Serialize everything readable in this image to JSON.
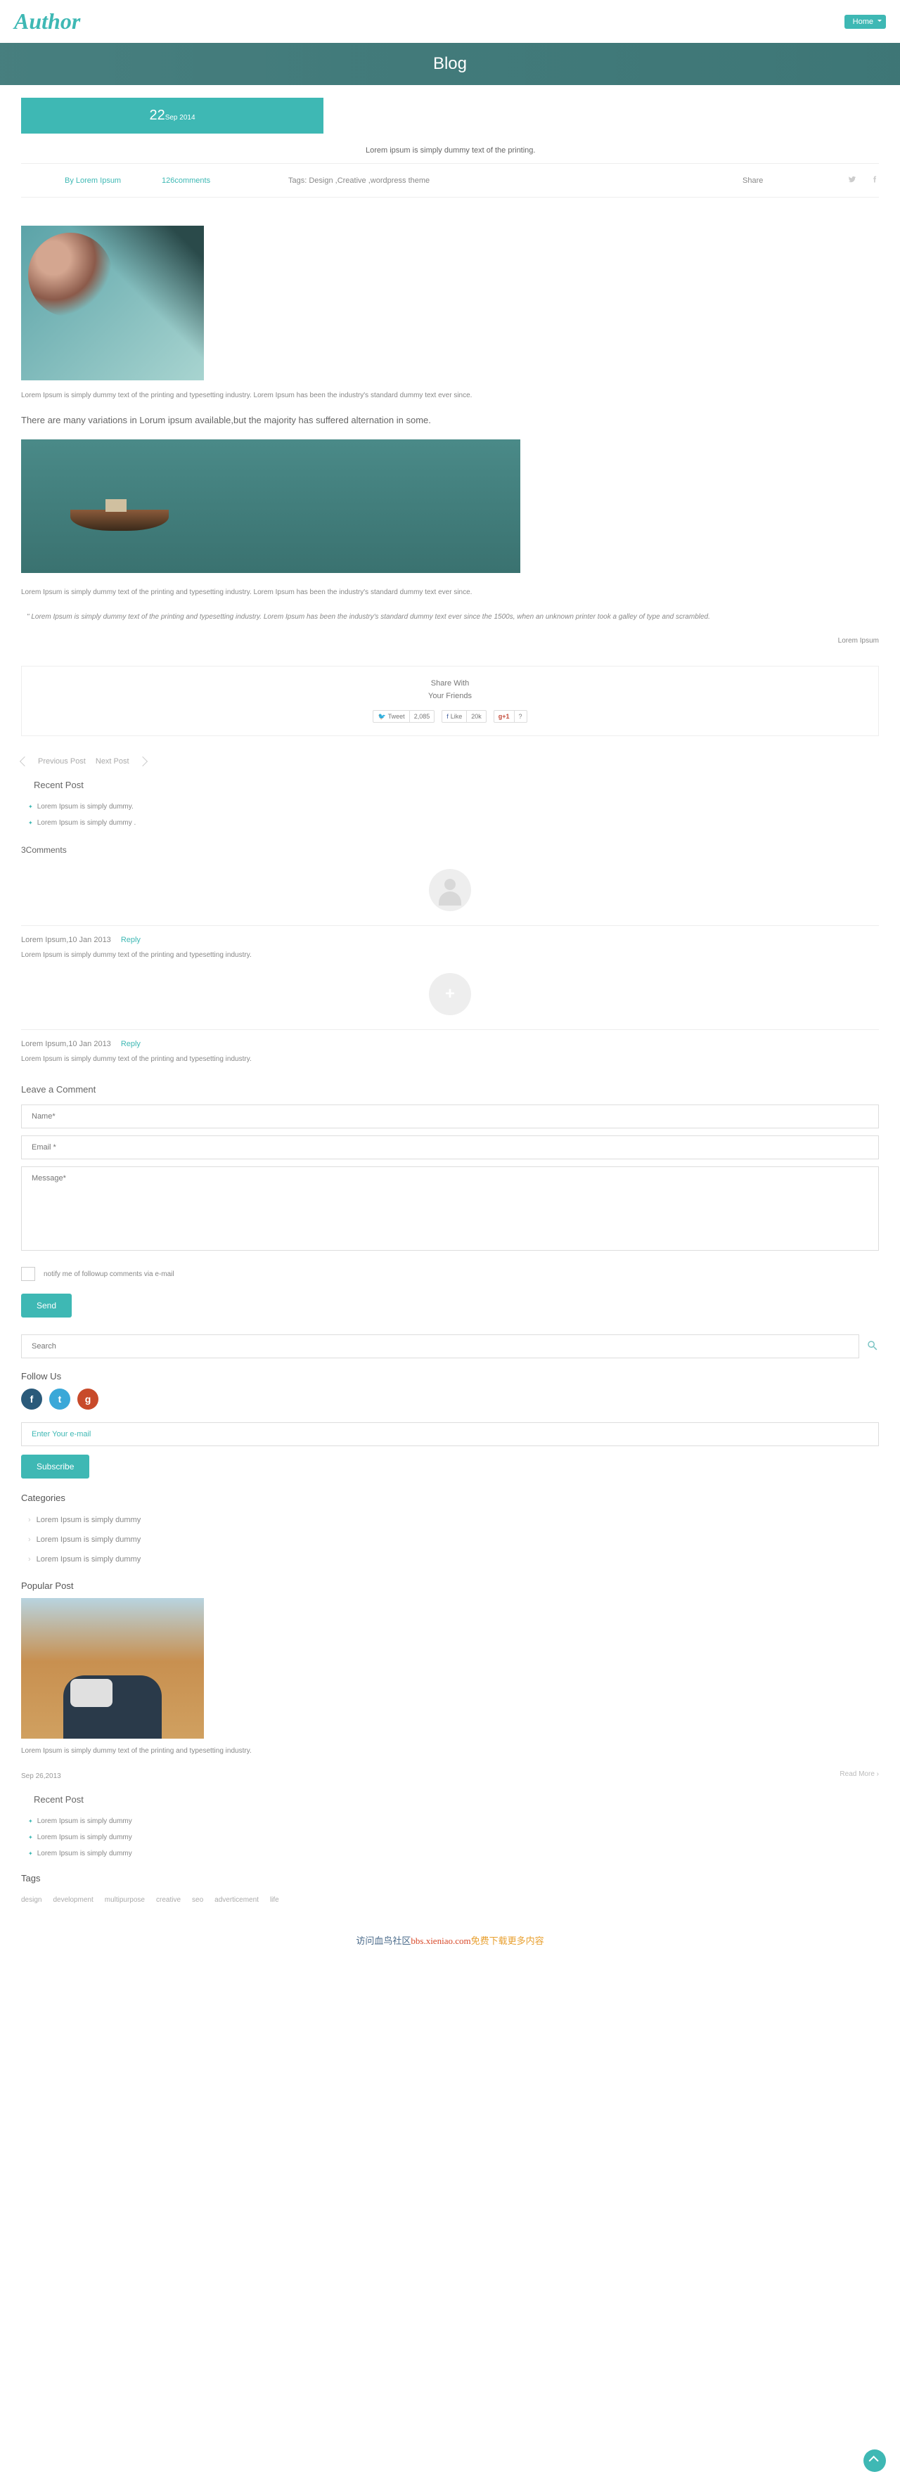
{
  "header": {
    "logo": "Author",
    "home_label": "Home"
  },
  "banner": {
    "title": "Blog"
  },
  "post": {
    "date_day": "22",
    "date_rest": "Sep 2014",
    "title": "Lorem ipsum is simply dummy text of the printing.",
    "by_label": "By",
    "author": "Lorem Ipsum",
    "comments": "126comments",
    "tags_label": "Tags: Design  ,Creative  ,wordpress theme",
    "share_label": "Share",
    "p1": "Lorem Ipsum is simply dummy text of the printing and typesetting industry. Lorem Ipsum has been the industry's standard dummy text ever since.",
    "h1": "There are many variations in Lorum ipsum available,but the majority has suffered alternation in some.",
    "p2": "Lorem Ipsum is simply dummy text of the printing and typesetting industry. Lorem Ipsum has been the industry's standard dummy text ever since.",
    "quote": "\"  Lorem Ipsum is simply dummy text of the printing and typesetting industry. Lorem Ipsum has been the industry's standard dummy text ever since the 1500s, when an unknown printer took a galley of type and scrambled.",
    "quote_src": "Lorem Ipsum"
  },
  "share_box": {
    "l1": "Share With",
    "l2": "Your Friends",
    "tweet": "Tweet",
    "tweet_n": "2,085",
    "like": "Like",
    "like_n": "20k",
    "gplus": "g+1",
    "gplus_n": "?"
  },
  "nav": {
    "prev": "Previous Post",
    "next": "Next Post"
  },
  "recent": {
    "title": "Recent Post",
    "items": [
      "Lorem Ipsum is simply dummy.",
      "Lorem Ipsum is simply dummy ."
    ]
  },
  "comments": {
    "heading": "3Comments",
    "items": [
      {
        "meta": "Lorem Ipsum,10 Jan 2013",
        "reply": "Reply",
        "text": "Lorem Ipsum is simply dummy text of the printing and typesetting industry."
      },
      {
        "meta": "Lorem Ipsum,10 Jan 2013",
        "reply": "Reply",
        "text": "Lorem Ipsum is simply dummy text of the printing and typesetting industry."
      }
    ]
  },
  "form": {
    "heading": "Leave a Comment",
    "name_ph": "Name*",
    "email_ph": "Email *",
    "msg_ph": "Message*",
    "notify": "notify me of followup comments via e-mail",
    "send": "Send"
  },
  "search": {
    "ph": "Search"
  },
  "follow": {
    "title": "Follow Us"
  },
  "subscribe": {
    "ph": "Enter Your e-mail",
    "btn": "Subscribe"
  },
  "categories": {
    "title": "Categories",
    "items": [
      "Lorem Ipsum is simply dummy",
      "Lorem Ipsum is simply dummy",
      "Lorem Ipsum is simply dummy"
    ]
  },
  "popular": {
    "title": "Popular Post",
    "text": "Lorem Ipsum is simply dummy text of the printing and typesetting industry.",
    "date": "Sep 26,2013",
    "readmore": "Read More"
  },
  "recent2": {
    "title": "Recent Post",
    "items": [
      "Lorem Ipsum is simply dummy",
      "Lorem Ipsum is simply dummy",
      "Lorem Ipsum is simply dummy"
    ]
  },
  "tags": {
    "title": "Tags",
    "items": [
      "design",
      "development",
      "multipurpose",
      "creative",
      "seo",
      "adverticement",
      "life"
    ]
  },
  "footer": {
    "t1": "访问血鸟社区",
    "t2": "bbs.xieniao.com",
    "t3": "免费下载更多内容"
  }
}
